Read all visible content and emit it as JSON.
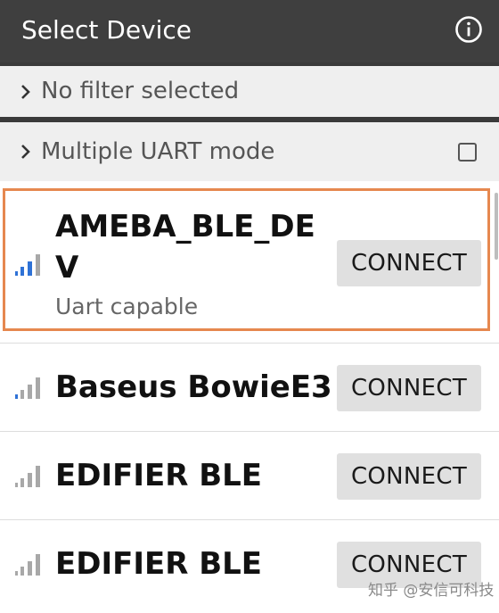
{
  "app_bar": {
    "title": "Select Device",
    "info_icon": "info-icon"
  },
  "filter_row": {
    "label": "No filter selected",
    "icon": "chevron-right-icon"
  },
  "uart_row": {
    "label": "Multiple UART mode",
    "icon": "chevron-right-icon",
    "checked": false
  },
  "devices": [
    {
      "name": "AMEBA_BLE_DE\nV",
      "subtitle": "Uart capable",
      "button": "CONNECT",
      "signal_bars_active": 3,
      "signal_color": "#2f72d6",
      "highlighted": true
    },
    {
      "name": "Baseus BowieE3",
      "button": "CONNECT",
      "signal_bars_active": 1,
      "signal_color": "#2f72d6",
      "highlighted": false
    },
    {
      "name": "EDIFIER BLE",
      "button": "CONNECT",
      "signal_bars_active": 0,
      "signal_color": "#a8a8a8",
      "highlighted": false
    },
    {
      "name": "EDIFIER BLE",
      "button": "CONNECT",
      "signal_bars_active": 0,
      "signal_color": "#a8a8a8",
      "highlighted": false
    }
  ],
  "watermark": "知乎 @安信可科技",
  "colors": {
    "app_bar": "#3f3f3f",
    "highlight_border": "#e6884f",
    "signal_active": "#2f72d6",
    "signal_inactive": "#a8a8a8"
  }
}
